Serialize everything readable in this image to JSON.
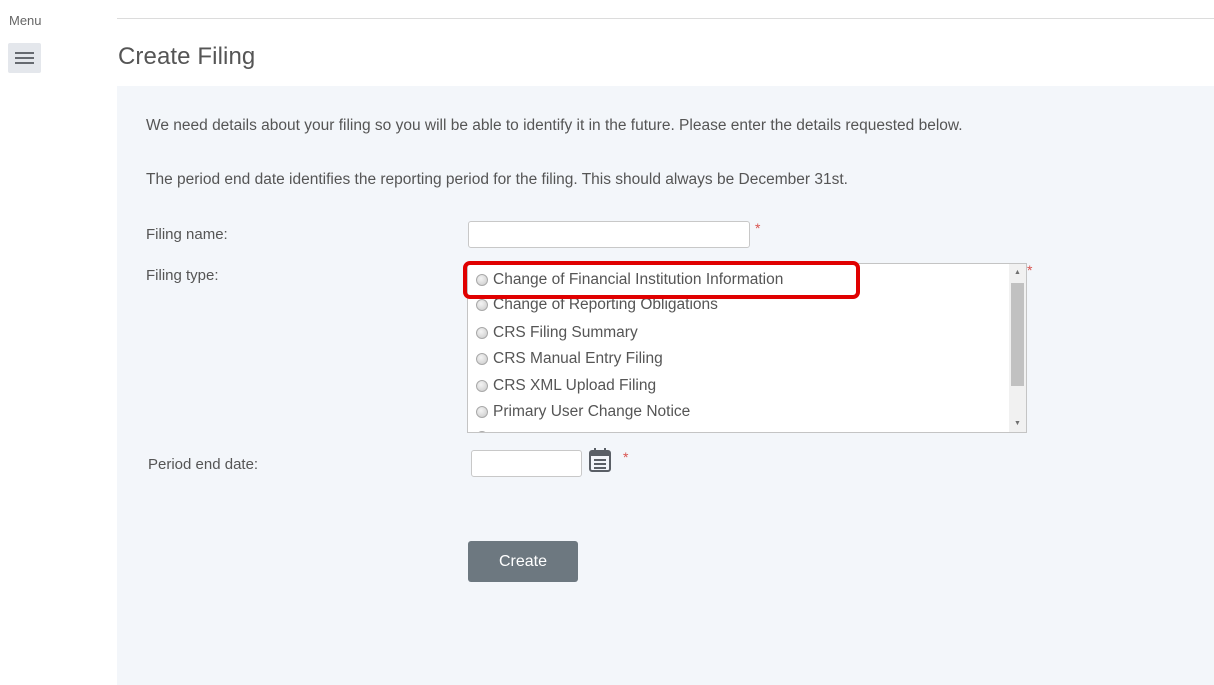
{
  "menu": {
    "label": "Menu"
  },
  "page": {
    "title": "Create Filing"
  },
  "intro": {
    "line1": "We need details about your filing so you will be able to identify it in the future. Please enter the details requested below.",
    "line2": "The period end date identifies the reporting period for the filing. This should always be December 31st."
  },
  "form": {
    "filing_name": {
      "label": "Filing name:",
      "value": "",
      "required_mark": "*"
    },
    "filing_type": {
      "label": "Filing type:",
      "required_mark": "*",
      "options": [
        "Change of Financial Institution Information",
        "Change of Reporting Obligations",
        "CRS Filing Summary",
        "CRS Manual Entry Filing",
        "CRS XML Upload Filing",
        "Primary User Change Notice"
      ],
      "highlighted_option": "Change of Financial Institution Information"
    },
    "period_end_date": {
      "label": "Period end date:",
      "value": "",
      "required_mark": "*"
    },
    "create_button": "Create"
  },
  "colors": {
    "panel_background": "#f3f6fa",
    "button": "#6d7880",
    "required": "#d9534f",
    "highlight": "#e00000"
  },
  "icons": {
    "menu": "hamburger-icon",
    "calendar": "calendar-icon"
  }
}
